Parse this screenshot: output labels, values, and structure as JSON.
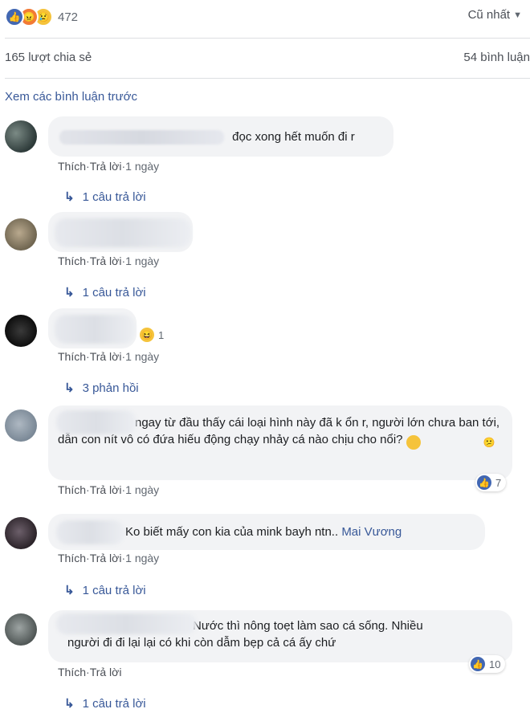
{
  "reactions": {
    "count": "472",
    "icons": [
      "like-icon",
      "angry-icon",
      "sad-icon"
    ]
  },
  "sort": {
    "label": "Cũ nhất"
  },
  "stats": {
    "shares": "165 lượt chia sẻ",
    "comments": "54 bình luận"
  },
  "view_previous": "Xem các bình luận trước",
  "actions": {
    "like": "Thích",
    "reply": "Trả lời",
    "sep": " · "
  },
  "comments": [
    {
      "text": "đọc xong hết muốn đi r",
      "time": "1 ngày",
      "replies": "1 câu trả lời"
    },
    {
      "text": "",
      "time": "1 ngày",
      "replies": "1 câu trả lời"
    },
    {
      "text": "",
      "time": "1 ngày",
      "reaction_count": "1",
      "replies": "3 phản hồi"
    },
    {
      "text": "ngay từ đầu thấy cái loại hình này đã k ổn r, người lớn chưa ban tới, dẫn con nít vô có đứa hiếu động chạy nhảy cá nào chịu cho nổi?",
      "time": "1 ngày",
      "likes": "7"
    },
    {
      "text": "Ko biết mấy con kia của mink bayh ntn..",
      "mention": "Mai Vương",
      "time": "1 ngày",
      "replies": "1 câu trả lời"
    },
    {
      "text_line1": "Nước thì nông toẹt làm sao cá sống. Nhiều",
      "text_line2": "người đi đi lại lại có khi còn dẫm bẹp cả cá ấy chứ",
      "likes": "10",
      "replies": "1 câu trả lời"
    }
  ],
  "colors": {
    "link": "#385898",
    "bubble": "#f2f3f5",
    "like_blue": "#4267b2"
  }
}
